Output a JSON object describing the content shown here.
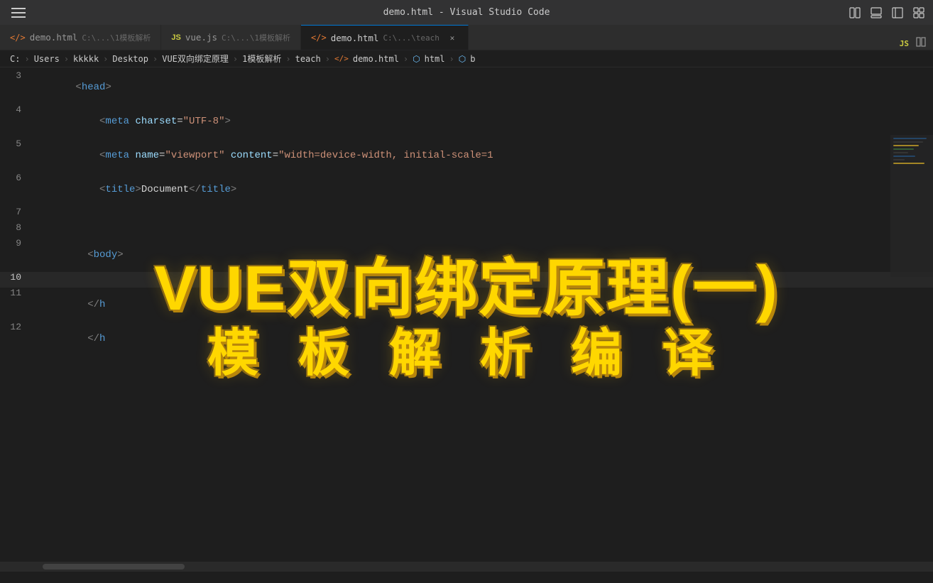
{
  "titlebar": {
    "title": "demo.html - Visual Studio Code"
  },
  "tabs": [
    {
      "id": "tab-demo-inactive",
      "icon_type": "html",
      "filename": "demo.html",
      "path": "C:\\...\\1模板解析",
      "active": false,
      "show_close": false
    },
    {
      "id": "tab-vue-inactive",
      "icon_type": "js",
      "filename": "vue.js",
      "path": "C:\\...\\1模板解析",
      "active": false,
      "show_close": false
    },
    {
      "id": "tab-demo-active",
      "icon_type": "html",
      "filename": "demo.html",
      "path": "C:\\...\\teach",
      "active": true,
      "show_close": true
    }
  ],
  "breadcrumb": {
    "items": [
      "C:",
      "Users",
      "kkkkk",
      "Desktop",
      "VUE双向绑定原理",
      "1模板解析",
      "teach",
      "demo.html",
      "html",
      "b"
    ]
  },
  "code_lines": [
    {
      "number": "3",
      "content": "  <head>",
      "type": "head_tag"
    },
    {
      "number": "4",
      "content": "    <meta charset=\"UTF-8\">",
      "type": "meta"
    },
    {
      "number": "5",
      "content": "    <meta name=\"viewport\" content=\"width=device-width, initial-scale=1",
      "type": "meta_viewport"
    },
    {
      "number": "6",
      "content": "    <title>Document</title>",
      "type": "title"
    },
    {
      "number": "7",
      "content": "",
      "type": "empty"
    },
    {
      "number": "8",
      "content": "",
      "type": "empty"
    },
    {
      "number": "9",
      "content": "  <body>",
      "type": "body_tag"
    },
    {
      "number": "10",
      "content": "",
      "type": "empty",
      "active": true
    },
    {
      "number": "11",
      "content": "  </",
      "type": "closing"
    },
    {
      "number": "12",
      "content": "  </",
      "type": "closing"
    }
  ],
  "overlay": {
    "line1": "VUE双向绑定原理(一)",
    "line2": "模  板  解  析  编  译"
  },
  "scrollbar": {
    "visible": true
  }
}
